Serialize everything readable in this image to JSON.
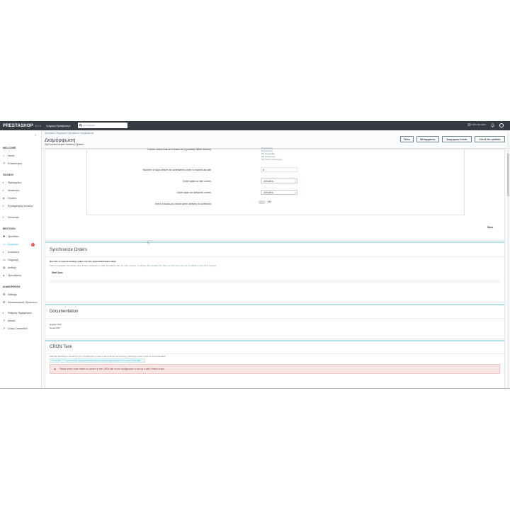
{
  "topbar": {
    "logo": "PRESTASHOP",
    "version": "8.1.0",
    "quick_access": "Γρήγορη Πρόσβαση ▾",
    "search_placeholder": "Αναζήτηση",
    "view_shop": "View my store"
  },
  "sidebar": {
    "sections": [
      {
        "title": "WELCOME",
        "items": [
          "Home",
          "Επισκόπηση"
        ]
      },
      {
        "title": "ΠΩΛΗΣΗ",
        "items": [
          "Παραγγελίες",
          "Κατάλογος",
          "Πελάτες",
          "Εξυπηρέτηση πελατών",
          "Στατιστικά"
        ]
      },
      {
        "title": "ΒΕΛΤΙΩΣΗ",
        "items": [
          "Προσθετα",
          "Εμφάνιση",
          "Αποστολή",
          "Πληρωμή",
          "Διεθνής",
          "Προωθήσεις"
        ]
      },
      {
        "title": "ΔΙΑΜΟΡΦΩΣΗ",
        "items": [
          "Settings",
          "Κατασκευαστές Προϊόντων",
          "Ρύθμιση Παραμέτρων",
          "Advice",
          "Cross Connection"
        ]
      }
    ],
    "badge": "1"
  },
  "header": {
    "breadcrumb": "Προσθετα  /  Διαχείριση Προσθέτων  /  Διαμόρφωση",
    "title": "Διαμόρφωση",
    "subtitle": "ZipCourierGreece Delivery System",
    "buttons": [
      "Πίσω",
      "Μεταφράσεις",
      "Διαχείριση hooks",
      "Check for updates"
    ]
  },
  "settings": {
    "status_label": "Courier status that are treated as a possibly failed delivery",
    "status_options": [
      "Σε Αναμονή",
      "Σε Αναμονή",
      "Μη Παραλαβή",
      "Μη Αναζήτηση",
      "Μη Τρόπο Αποστολής"
    ],
    "days_label": "Number of days before an undelivered order is marked as late",
    "days_value": "5",
    "late_label": "Order state for late orders",
    "late_value": "--Επιλέξτε--",
    "delivered_label": "Order state for delivered orders",
    "delivered_value": "--Επιλέξτε--",
    "email_label": "Send a thank-you email when delivery is confirmed",
    "email_toggle": "NO",
    "save": "Save"
  },
  "sync": {
    "title": "Synchronize Orders",
    "line1": "Run this to import existing orders into the zipCourierGreece table.",
    "line2": "This is especially convenient after a new installation or after upgrading from an older version. Configure the module first, then run this once. Do not run while a cron job is running.",
    "button": "Start Sync"
  },
  "docs": {
    "title": "Documentation",
    "links": [
      "English PDF",
      "Greek PDF"
    ]
  },
  "cron": {
    "title": "CRON Task",
    "hint": "Add the following command to your crontab file (or use a tool such as cron-job.org). Running it every hour is recommended.",
    "url": "27.22.28 * * * * /usr/bin/php /var/www/html/modules/zipcouriergreece/cron.php token=xd7f4a9b",
    "alert": "Please select order states or carriers in the CRON tab on the configuration to set up a safe, limited scope."
  }
}
